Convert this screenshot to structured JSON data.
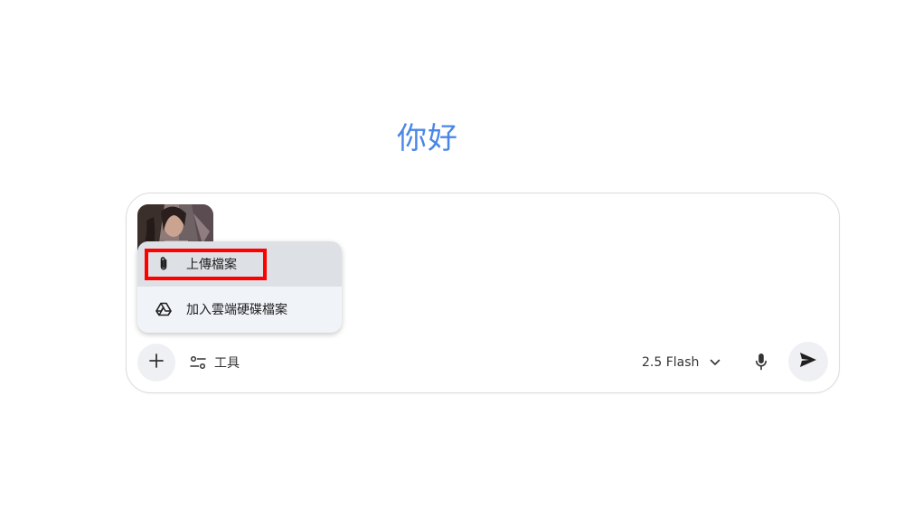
{
  "greeting": "你好",
  "attachment": {
    "type": "image-thumbnail"
  },
  "menu": {
    "items": [
      {
        "label": "上傳檔案",
        "icon": "paperclip-icon",
        "hovered": true
      },
      {
        "label": "加入雲端硬碟檔案",
        "icon": "drive-icon",
        "hovered": false
      }
    ]
  },
  "toolbar": {
    "plus_icon": "plus-icon",
    "tools_label": "工具",
    "tools_icon": "tune-icon",
    "model_label": "2.5 Flash",
    "model_icon": "chevron-down-icon",
    "mic_icon": "mic-icon",
    "send_icon": "send-icon"
  },
  "colors": {
    "greeting": "#4a86e8",
    "menu_bg": "#f0f4f9",
    "menu_hover": "#dde0e5",
    "highlight": "#ff0000"
  }
}
